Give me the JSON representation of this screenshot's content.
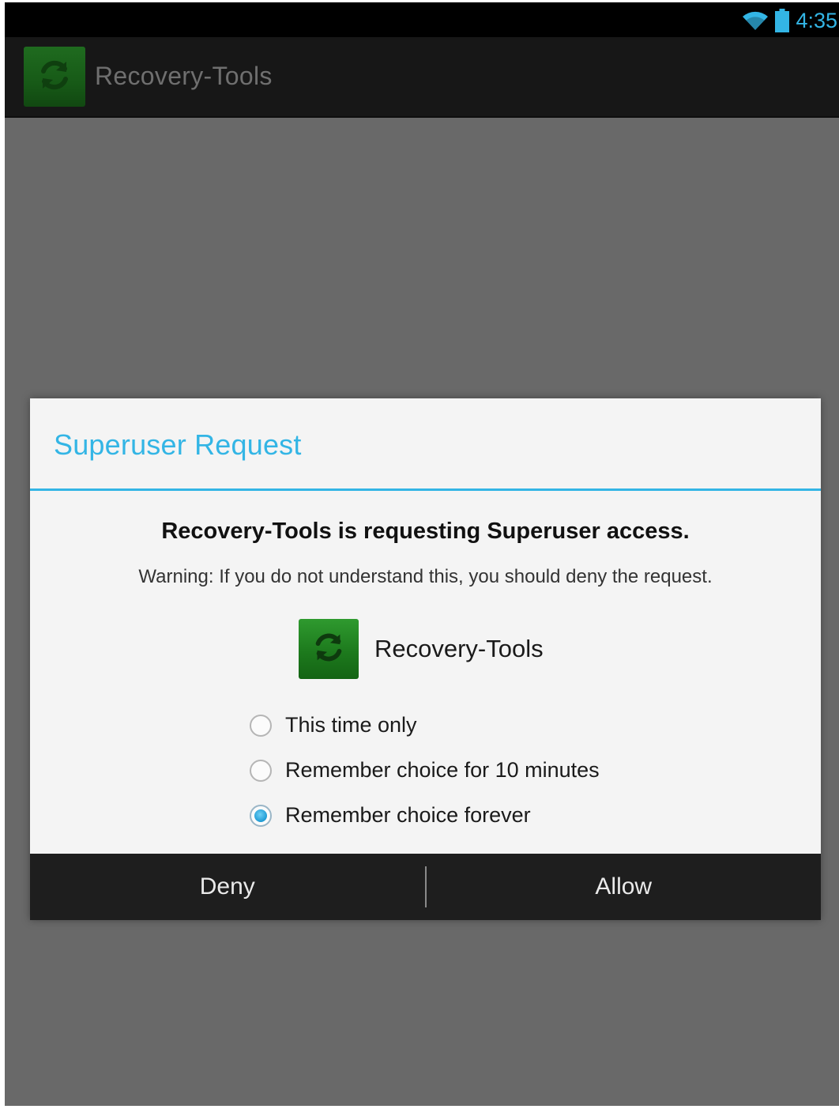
{
  "status_bar": {
    "time": "4:35",
    "icons": [
      "wifi-icon",
      "battery-icon"
    ],
    "accent_color": "#33b5e5"
  },
  "action_bar": {
    "app_title": "Recovery-Tools",
    "icon": "refresh-icon"
  },
  "dialog": {
    "title": "Superuser Request",
    "heading": "Recovery-Tools is requesting Superuser access.",
    "warning": "Warning: If you do not understand this, you should deny the request.",
    "app_name": "Recovery-Tools",
    "app_icon": "refresh-icon",
    "options": [
      {
        "label": "This time only",
        "selected": false
      },
      {
        "label": "Remember choice for 10 minutes",
        "selected": false
      },
      {
        "label": "Remember choice forever",
        "selected": true
      }
    ],
    "deny_label": "Deny",
    "allow_label": "Allow"
  }
}
